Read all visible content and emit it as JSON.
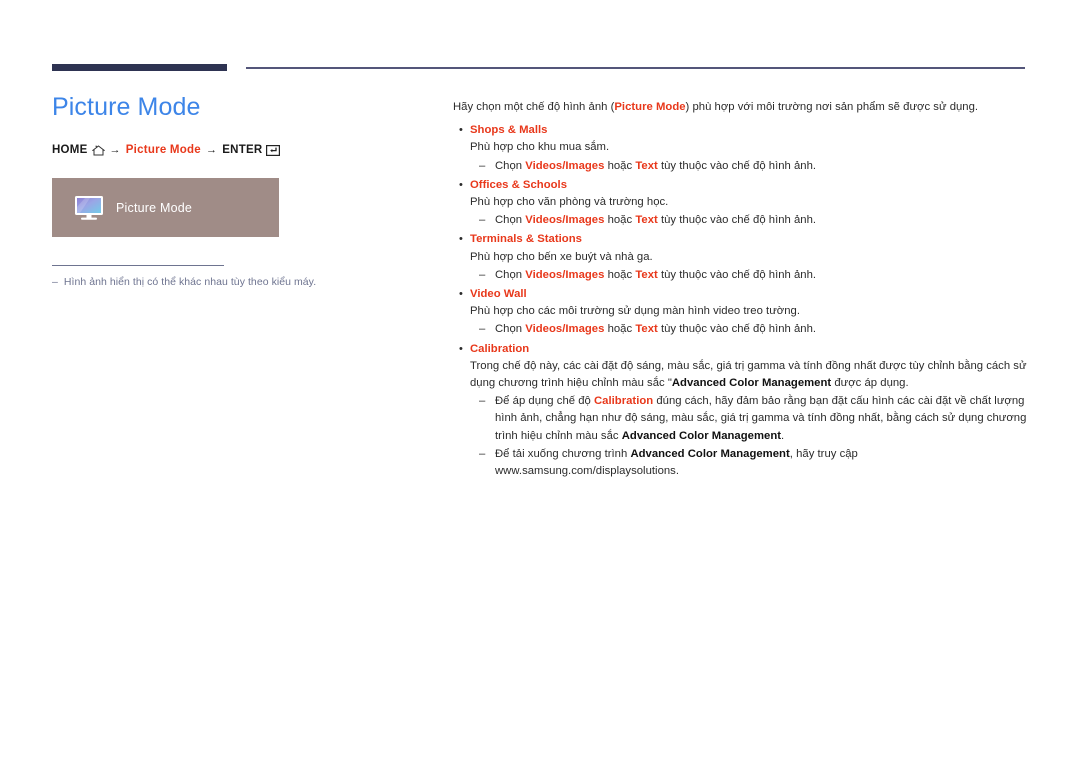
{
  "header": {
    "rule_color": "#2e3352",
    "thin_rule_color": "#54567a"
  },
  "left": {
    "title": "Picture Mode",
    "title_color": "#3d85e8",
    "breadcrumb": {
      "home_label": "HOME",
      "home_icon": "home-icon",
      "arrow1": "→",
      "middle_label": "Picture Mode",
      "arrow2": "→",
      "enter_label": "ENTER",
      "enter_icon": "enter-key-icon",
      "accent_color": "#e8381b"
    },
    "menu_box": {
      "icon": "monitor-icon",
      "label": "Picture Mode",
      "bg_color": "#a08c87"
    },
    "note": {
      "dash": "‒",
      "text": "Hình ảnh hiển thị có thể khác nhau tùy theo kiểu máy.",
      "color": "#6e7490"
    }
  },
  "right": {
    "intro": {
      "pre": "Hãy chọn một chế độ hình ảnh (",
      "highlight": "Picture Mode",
      "post": ") phù hợp với môi trường nơi sản phẩm sẽ được sử dụng."
    },
    "bullet_mark": "•",
    "sub_mark": "‒",
    "choose_line": {
      "pre": "Chọn ",
      "opt1": "Videos/Images",
      "mid": " hoặc ",
      "opt2": "Text",
      "post": " tùy thuộc vào chế độ hình ảnh."
    },
    "items": [
      {
        "title": "Shops & Malls",
        "desc": "Phù hợp cho khu mua sắm.",
        "has_choose": true
      },
      {
        "title": "Offices & Schools",
        "desc": "Phù hợp cho văn phòng và trường học.",
        "has_choose": true
      },
      {
        "title": "Terminals & Stations",
        "desc": "Phù hợp cho bến xe buýt và nhà ga.",
        "has_choose": true
      },
      {
        "title": "Video Wall",
        "desc": "Phù hợp cho các môi trường sử dụng màn hình video treo tường.",
        "has_choose": true
      }
    ],
    "calibration": {
      "title": "Calibration",
      "desc_a": "Trong chế độ này, các cài đặt độ sáng, màu sắc, giá trị gamma và tính đồng nhất được tùy chỉnh bằng cách sử dụng chương trình hiệu chỉnh màu sắc \"",
      "desc_a_bold": "Advanced Color Management",
      "desc_a_end": " được áp dụng.",
      "sub1_pre": "Để áp dụng chế độ ",
      "sub1_red": "Calibration",
      "sub1_mid": " đúng cách, hãy đảm bảo rằng bạn đặt cấu hình các cài đặt về chất lượng hình ảnh, chẳng hạn như độ sáng, màu sắc, giá trị gamma và tính đồng nhất, bằng cách sử dụng chương trình hiệu chỉnh màu sắc ",
      "sub1_bold": "Advanced Color Management",
      "sub1_end": ".",
      "sub2_pre": "Để tải xuống chương trình ",
      "sub2_bold": "Advanced Color Management",
      "sub2_end": ", hãy truy cập www.samsung.com/displaysolutions."
    }
  }
}
